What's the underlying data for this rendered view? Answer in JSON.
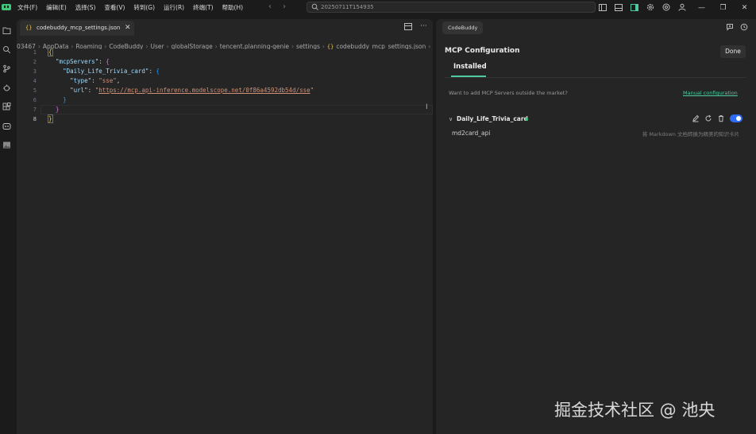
{
  "menu": [
    "文件(F)",
    "编辑(E)",
    "选择(S)",
    "查看(V)",
    "转到(G)",
    "运行(R)",
    "终端(T)",
    "帮助(H)"
  ],
  "search": {
    "text": "20250711T154935"
  },
  "editor": {
    "tab_label": "codebuddy_mcp_settings.json",
    "tab_icon": "{}",
    "breadcrumb": [
      "03467",
      "AppData",
      "Roaming",
      "CodeBuddy",
      "User",
      "globalStorage",
      "tencent.planning-genie",
      "settings"
    ],
    "breadcrumb_file": "codebuddy_mcp_settings.json",
    "breadcrumb_tail": "...",
    "line_numbers": [
      "1",
      "2",
      "3",
      "4",
      "5",
      "6",
      "7",
      "8"
    ],
    "code": {
      "l1_open": "{",
      "l2_key": "\"mcpServers\"",
      "l2_colon": ": ",
      "l2_brace": "{",
      "l3_key": "\"Daily_Life_Trivia_card\"",
      "l3_colon": ": ",
      "l3_brace": "{",
      "l4_key": "\"type\"",
      "l4_colon": ": ",
      "l4_val": "\"sse\"",
      "l4_comma": ",",
      "l5_key": "\"url\"",
      "l5_colon": ": ",
      "l5_q1": "\"",
      "l5_url": "https://mcp.api-inference.modelscope.net/0f86a4592db54d/sse",
      "l5_q2": "\"",
      "l6_close": "}",
      "l7_close": "}",
      "l8_close": "}"
    }
  },
  "panel": {
    "tab_label": "CodeBuddy",
    "title": "MCP Configuration",
    "done_label": "Done",
    "installed_tab": "Installed",
    "want_text": "Want to add MCP Servers outside the market?",
    "manual_link": "Manual configuration",
    "server": {
      "name": "Daily_Life_Trivia_card",
      "enabled": true,
      "status_color": "#3ec77a",
      "tool_name": "md2card_api",
      "tool_desc": "将 Markdown 文档转换为精美的知识卡片"
    }
  },
  "watermark": "掘金技术社区 @ 池央",
  "colors": {
    "accent": "#4ec9a0",
    "toggle": "#2f6cf6"
  }
}
